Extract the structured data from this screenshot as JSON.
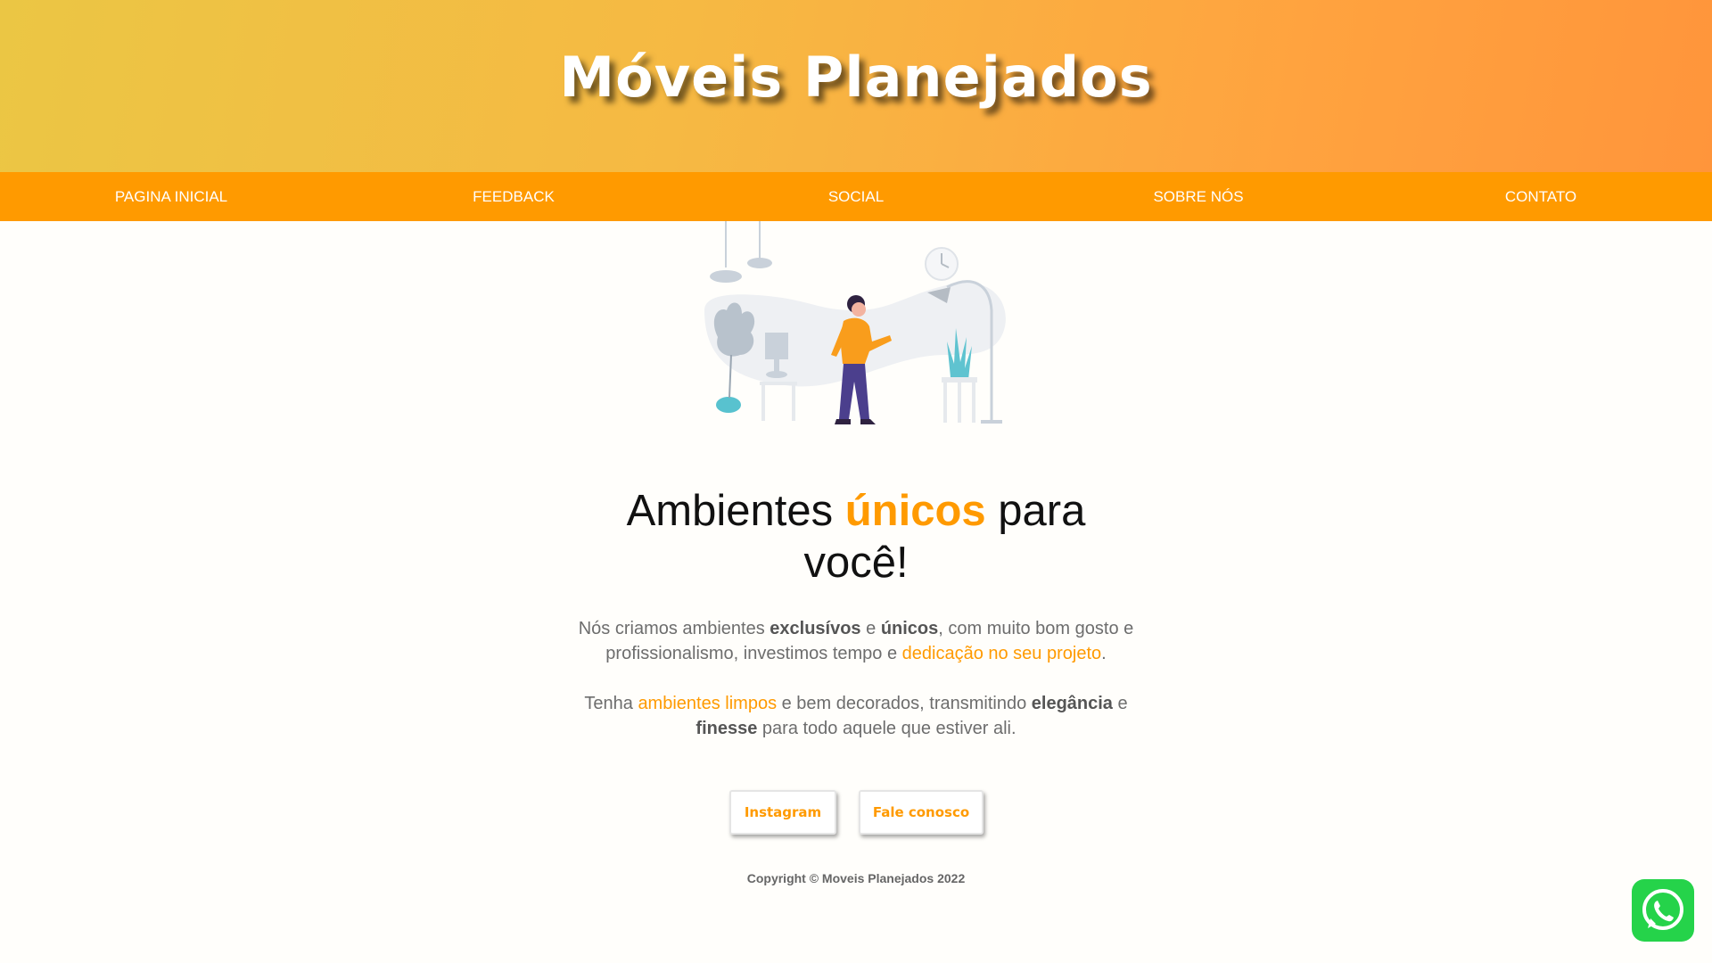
{
  "header": {
    "title": "Móveis Planejados"
  },
  "nav": {
    "items": [
      {
        "label": "PAGINA INICIAL"
      },
      {
        "label": "FEEDBACK"
      },
      {
        "label": "SOCIAL"
      },
      {
        "label": "SOBRE NÓS"
      },
      {
        "label": "CONTATO"
      }
    ]
  },
  "hero": {
    "illustration_icon": "person-arranging-room-illustration",
    "headline_part1": "Ambientes ",
    "headline_accent": "únicos",
    "headline_part2": " para você!",
    "p1": {
      "t1": "Nós criamos ambientes ",
      "b1": "exclusívos",
      "t2": " e ",
      "b2": "únicos",
      "t3": ", com muito bom gosto e profissionalismo, investimos tempo e ",
      "hl1": "dedicação no seu projeto",
      "t4": "."
    },
    "p2": {
      "t1": "Tenha ",
      "hl1": "ambientes limpos",
      "t2": " e bem decorados, transmitindo ",
      "b1": "elegância",
      "t3": " e ",
      "b2": "finesse",
      "t4": " para todo aquele que estiver ali."
    }
  },
  "buttons": {
    "instagram": "Instagram",
    "contact": "Fale conosco"
  },
  "footer": {
    "copyright": "Copyright © Moveis Planejados 2022"
  },
  "floating": {
    "whatsapp_icon": "whatsapp-icon"
  },
  "colors": {
    "accent": "#ff9a00",
    "header_gradient_start": "#ebc644",
    "header_gradient_end": "#ff953b",
    "whatsapp_green": "#25d34a"
  }
}
